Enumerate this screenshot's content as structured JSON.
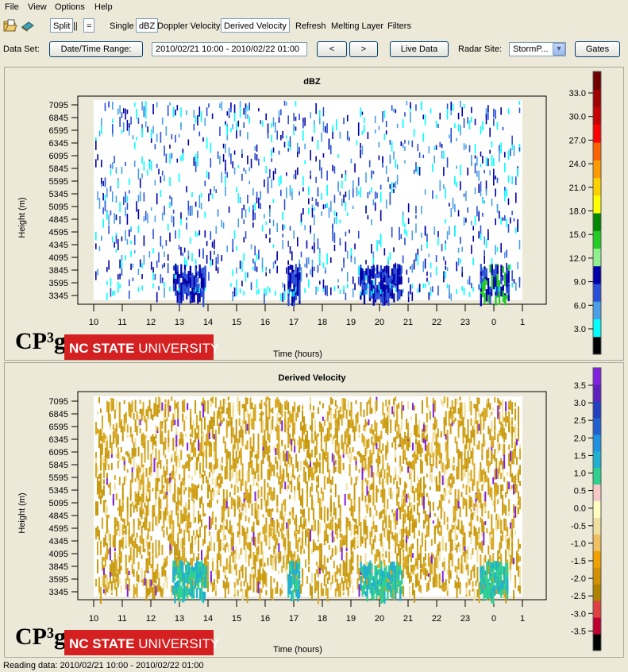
{
  "menu": [
    "File",
    "View",
    "Options",
    "Help"
  ],
  "toolbar": {
    "open_icon": "open-folder-icon",
    "save_icon": "book-icon",
    "split_label": "Split",
    "vsplit_label": "||",
    "hsplit_label": "=",
    "single_label": "Single",
    "dbz_label": "dBZ",
    "doppler_label": "Doppler Velocity",
    "derived_label": "Derived Velocity",
    "refresh_label": "Refresh",
    "melting_label": "Melting Layer",
    "filters_label": "Filters"
  },
  "dataset": {
    "label": "Data Set:",
    "range_button": "Date/Time Range:",
    "range_value": "2010/02/21 10:00 - 2010/02/22 01:00",
    "prev_label": "<",
    "next_label": ">",
    "live_label": "Live Data",
    "site_label": "Radar Site:",
    "site_value": "StormP...",
    "gates_label": "Gates"
  },
  "plots": [
    {
      "title": "dBZ",
      "xlabel": "Time (hours)",
      "ylabel": "Height (m)",
      "logo_text": "CP³g",
      "banner_bold": "NC STATE",
      "banner_light": "UNIVERSITY",
      "colorbar_labels": [
        "33.0",
        "30.0",
        "27.0",
        "24.0",
        "21.0",
        "18.0",
        "15.0",
        "12.0",
        "9.0",
        "6.0",
        "3.0"
      ],
      "colorbar_colors": [
        "#000000",
        "#00ffff",
        "#4a9fe8",
        "#2a4fd8",
        "#0000a8",
        "#90f090",
        "#22cc22",
        "#008800",
        "#ffff00",
        "#ffd000",
        "#ff9900",
        "#ff6000",
        "#ff0000",
        "#c80000",
        "#a00000",
        "#700000"
      ]
    },
    {
      "title": "Derived Velocity",
      "xlabel": "Time (hours)",
      "ylabel": "Height (m)",
      "logo_text": "CP³g",
      "banner_bold": "NC STATE",
      "banner_light": "UNIVERSITY",
      "colorbar_labels": [
        "3.5",
        "3.0",
        "2.5",
        "2.0",
        "1.5",
        "1.0",
        "0.5",
        "0.0",
        "-0.5",
        "-1.0",
        "-1.5",
        "-2.0",
        "-2.5",
        "-3.0",
        "-3.5"
      ],
      "colorbar_colors": [
        "#000000",
        "#c00030",
        "#e04040",
        "#b08000",
        "#d09000",
        "#f0a000",
        "#f0c060",
        "#f0e0a0",
        "#ffffc0",
        "#f8c8c8",
        "#30d090",
        "#20b0d0",
        "#2090e0",
        "#2060d0",
        "#2040c0",
        "#6020c0",
        "#8020e0"
      ]
    }
  ],
  "chart_data": [
    {
      "type": "heatmap",
      "title": "dBZ",
      "xlabel": "Time (hours)",
      "ylabel": "Height (m)",
      "x_ticks": [
        "10",
        "11",
        "12",
        "13",
        "14",
        "15",
        "16",
        "17",
        "18",
        "19",
        "20",
        "21",
        "22",
        "23",
        "0",
        "1"
      ],
      "y_ticks": [
        7095,
        6845,
        6595,
        6345,
        6095,
        5845,
        5595,
        5345,
        5095,
        4845,
        4595,
        4345,
        4095,
        3845,
        3595,
        3345
      ],
      "colorbar_range": [
        0,
        36
      ]
    },
    {
      "type": "heatmap",
      "title": "Derived Velocity",
      "xlabel": "Time (hours)",
      "ylabel": "Height (m)",
      "x_ticks": [
        "10",
        "11",
        "12",
        "13",
        "14",
        "15",
        "16",
        "17",
        "18",
        "19",
        "20",
        "21",
        "22",
        "23",
        "0",
        "1"
      ],
      "y_ticks": [
        7095,
        6845,
        6595,
        6345,
        6095,
        5845,
        5595,
        5345,
        5095,
        4845,
        4595,
        4345,
        4095,
        3845,
        3595,
        3345
      ],
      "colorbar_range": [
        -4,
        4
      ]
    }
  ],
  "status": "Reading data: 2010/02/21 10:00 - 2010/02/22 01:00"
}
